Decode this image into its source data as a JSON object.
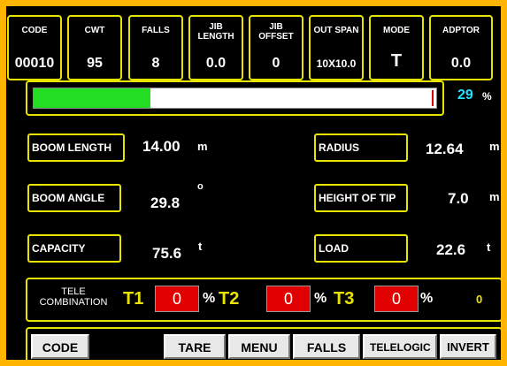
{
  "header": [
    {
      "label": "CODE",
      "value": "00010"
    },
    {
      "label": "CWT",
      "value": "95"
    },
    {
      "label": "FALLS",
      "value": "8"
    },
    {
      "label": "JIB\nLENGTH",
      "value": "0.0"
    },
    {
      "label": "JIB\nOFFSET",
      "value": "0"
    },
    {
      "label": "OUT SPAN",
      "value": "10X10.0"
    },
    {
      "label": "MODE",
      "value": "T"
    },
    {
      "label": "ADPTOR",
      "value": "0.0"
    }
  ],
  "load_bar": {
    "percent": 29,
    "percent_text": "29",
    "unit": "%",
    "fill_fraction": 0.29,
    "limit_fraction": 0.99
  },
  "params": {
    "boom_length": {
      "label": "BOOM LENGTH",
      "value": "14.00",
      "unit": "m"
    },
    "boom_angle": {
      "label": "BOOM ANGLE",
      "value": "29.8",
      "unit": "o"
    },
    "capacity": {
      "label": "CAPACITY",
      "value": "75.6",
      "unit": "t"
    },
    "radius": {
      "label": "RADIUS",
      "value": "12.64",
      "unit": "m"
    },
    "height_of_tip": {
      "label": "HEIGHT OF TIP",
      "value": "7.0",
      "unit": "m"
    },
    "load": {
      "label": "LOAD",
      "value": "22.6",
      "unit": "t"
    }
  },
  "tele": {
    "label": "TELE\nCOMBINATION",
    "t1": {
      "name": "T1",
      "value": "0",
      "unit": "%"
    },
    "t2": {
      "name": "T2",
      "value": "0",
      "unit": "%"
    },
    "t3": {
      "name": "T3",
      "value": "0",
      "unit": "%"
    },
    "extra": "0"
  },
  "buttons": {
    "code": "CODE",
    "tare": "TARE",
    "menu": "MENU",
    "falls": "FALLS",
    "telelogic": "TELELOGIC",
    "invert": "INVERT"
  },
  "colors": {
    "frame": "#ffb400",
    "border": "#e8e400",
    "fill": "#22dd22",
    "limit": "#d00000",
    "percent": "#22e0ff",
    "tele_box": "#e00000"
  }
}
